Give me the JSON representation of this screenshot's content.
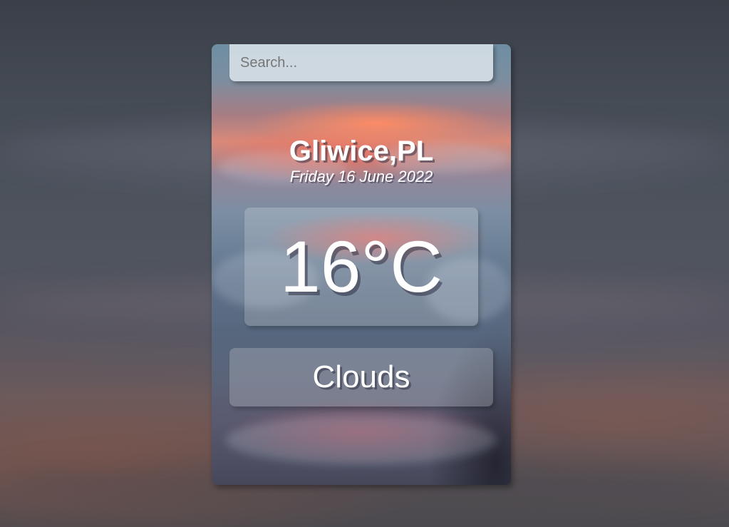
{
  "search": {
    "placeholder": "Search..."
  },
  "location": {
    "city": "Gliwice,PL",
    "date": "Friday 16 June 2022"
  },
  "current": {
    "temperature": "16°C",
    "weather": "Clouds"
  },
  "colors": {
    "text": "#ffffff",
    "panel": "rgba(255,255,255,0.2)",
    "search_bg": "rgba(225,232,238,0.82)",
    "sky_accent": "#d88a7a"
  }
}
